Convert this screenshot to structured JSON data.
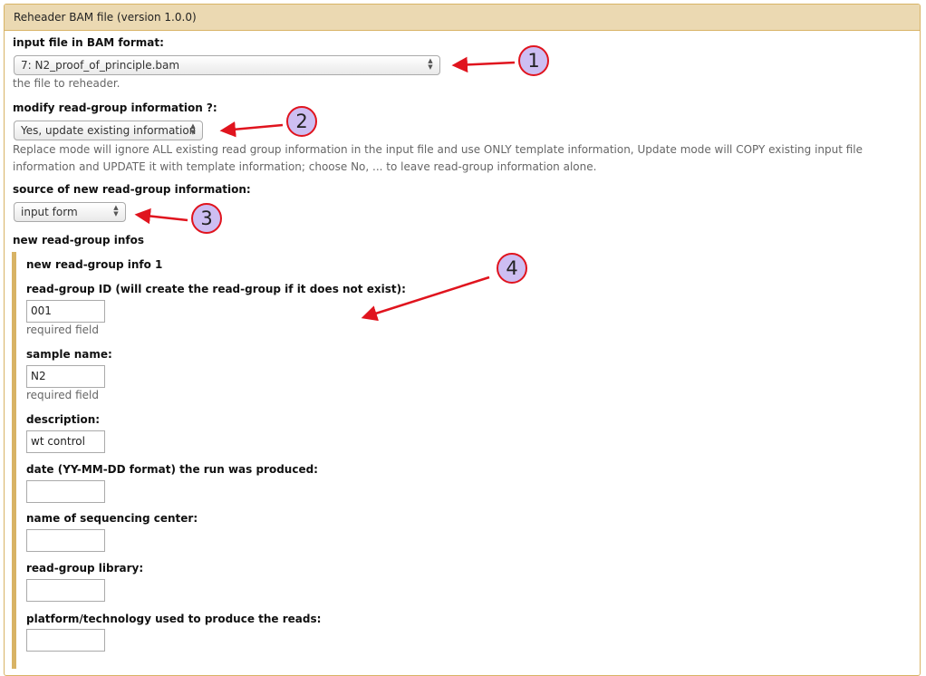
{
  "header": {
    "title": "Reheader BAM file (version 1.0.0)"
  },
  "input_file": {
    "label": "input file in BAM format:",
    "selected": "7: N2_proof_of_principle.bam",
    "help": "the file to reheader."
  },
  "modify_rg": {
    "label": "modify read-group information ?:",
    "selected": "Yes, update existing information",
    "help": "Replace mode will ignore ALL existing read group information in the input file and use ONLY template information, Update mode will COPY existing input file information and UPDATE it with template information; choose No, ... to leave read-group information alone."
  },
  "source": {
    "label": "source of new read-group information:",
    "selected": "input form"
  },
  "rg_infos": {
    "label": "new read-group infos",
    "item_title": "new read-group info 1",
    "id": {
      "label": "read-group ID (will create the read-group if it does not exist):",
      "value": "001",
      "help": "required field"
    },
    "sample": {
      "label": "sample name:",
      "value": "N2",
      "help": "required field"
    },
    "description": {
      "label": "description:",
      "value": "wt control"
    },
    "date": {
      "label": "date (YY-MM-DD format) the run was produced:",
      "value": ""
    },
    "center": {
      "label": "name of sequencing center:",
      "value": ""
    },
    "library": {
      "label": "read-group library:",
      "value": ""
    },
    "platform": {
      "label": "platform/technology used to produce the reads:",
      "value": ""
    }
  },
  "callouts": [
    "1",
    "2",
    "3",
    "4"
  ],
  "colors": {
    "accent_border": "#d8b365",
    "header_bg": "#ebd9b2",
    "callout_ring": "#e0141e",
    "callout_fill": "#cdbef2"
  }
}
